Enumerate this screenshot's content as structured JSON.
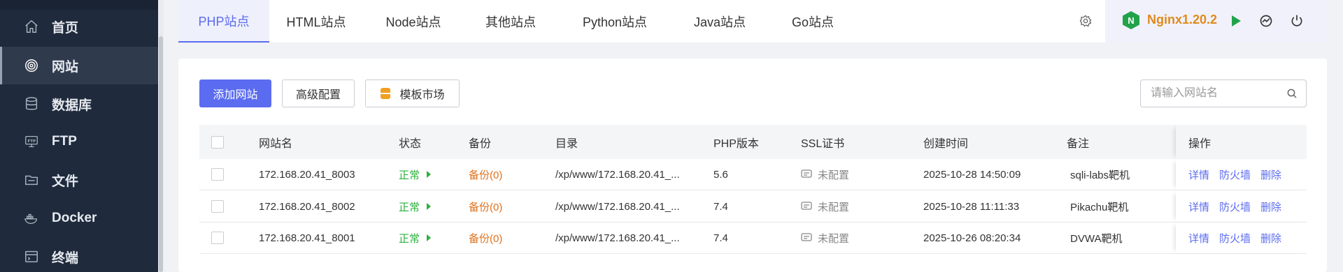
{
  "sidebar": {
    "items": [
      {
        "label": "首页",
        "icon": "home-icon"
      },
      {
        "label": "网站",
        "icon": "globe-icon",
        "active": true
      },
      {
        "label": "数据库",
        "icon": "database-icon"
      },
      {
        "label": "FTP",
        "icon": "ftp-icon"
      },
      {
        "label": "文件",
        "icon": "folder-icon"
      },
      {
        "label": "Docker",
        "icon": "docker-icon"
      },
      {
        "label": "终端",
        "icon": "terminal-icon"
      }
    ]
  },
  "tabs": [
    {
      "label": "PHP站点",
      "active": true
    },
    {
      "label": "HTML站点"
    },
    {
      "label": "Node站点"
    },
    {
      "label": "其他站点"
    },
    {
      "label": "Python站点"
    },
    {
      "label": "Java站点"
    },
    {
      "label": "Go站点"
    }
  ],
  "server": {
    "label": "Nginx1.20.2",
    "logo_letter": "N",
    "colors": {
      "nginx_green": "#22a34a",
      "label_orange": "#e08a1b",
      "play_green": "#22a34a"
    }
  },
  "toolbar": {
    "add_site": "添加网站",
    "advanced": "高级配置",
    "template_market": "模板市场",
    "search_placeholder": "请输入网站名"
  },
  "table": {
    "headers": {
      "name": "网站名",
      "status": "状态",
      "backup": "备份",
      "dir": "目录",
      "php": "PHP版本",
      "ssl": "SSL证书",
      "created": "创建时间",
      "note": "备注",
      "actions": "操作"
    },
    "rows": [
      {
        "name": "172.168.20.41_8003",
        "status": "正常",
        "backup": "备份(0)",
        "dir": "/xp/www/172.168.20.41_...",
        "php": "5.6",
        "ssl": "未配置",
        "created": "2025-10-28 14:50:09",
        "note": "sqli-labs靶机"
      },
      {
        "name": "172.168.20.41_8002",
        "status": "正常",
        "backup": "备份(0)",
        "dir": "/xp/www/172.168.20.41_...",
        "php": "7.4",
        "ssl": "未配置",
        "created": "2025-10-28 11:11:33",
        "note": "Pikachu靶机"
      },
      {
        "name": "172.168.20.41_8001",
        "status": "正常",
        "backup": "备份(0)",
        "dir": "/xp/www/172.168.20.41_...",
        "php": "7.4",
        "ssl": "未配置",
        "created": "2025-10-26 08:20:34",
        "note": "DVWA靶机"
      }
    ],
    "actions": {
      "detail": "详情",
      "firewall": "防火墙",
      "delete": "删除"
    }
  },
  "colors": {
    "primary": "#5b6cf0",
    "sidebar_bg": "#1f2a3c",
    "status_green": "#2bb03b",
    "backup_orange": "#e0701b"
  }
}
